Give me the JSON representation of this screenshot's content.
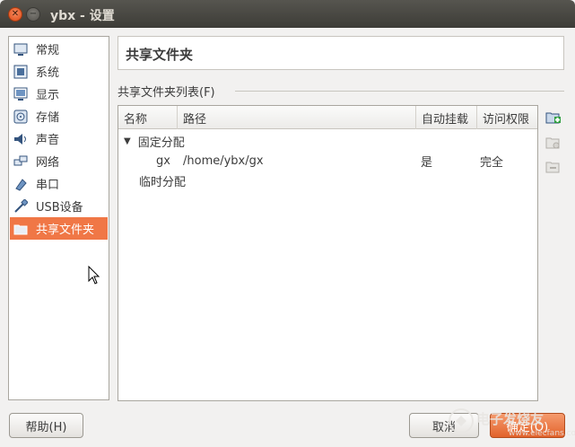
{
  "window": {
    "title": "ybx - 设置"
  },
  "sidebar": {
    "items": [
      {
        "label": "常规",
        "icon": "monitor-icon"
      },
      {
        "label": "系统",
        "icon": "chip-icon"
      },
      {
        "label": "显示",
        "icon": "display-icon"
      },
      {
        "label": "存储",
        "icon": "disk-icon"
      },
      {
        "label": "声音",
        "icon": "speaker-icon"
      },
      {
        "label": "网络",
        "icon": "network-icon"
      },
      {
        "label": "串口",
        "icon": "serial-port-icon"
      },
      {
        "label": "USB设备",
        "icon": "usb-icon"
      },
      {
        "label": "共享文件夹",
        "icon": "folder-icon"
      }
    ],
    "active_index": 8
  },
  "page": {
    "title": "共享文件夹",
    "list_label": "共享文件夹列表(F)"
  },
  "table": {
    "columns": [
      "名称",
      "路径",
      "自动挂载",
      "访问权限"
    ],
    "groups": [
      {
        "label": "固定分配",
        "expanded": true,
        "rows": [
          {
            "name": "gx",
            "path": "/home/ybx/gx",
            "automount": "是",
            "access": "完全"
          }
        ]
      },
      {
        "label": "临时分配",
        "expanded": false,
        "rows": []
      }
    ]
  },
  "buttons": {
    "help": "帮助(H)",
    "cancel": "取消",
    "ok": "确定(O)"
  },
  "watermark": {
    "text": "电子发烧友",
    "sub": "www.elecfans.com"
  },
  "colors": {
    "accent": "#f07746",
    "titlebar": "#3d3c37"
  }
}
